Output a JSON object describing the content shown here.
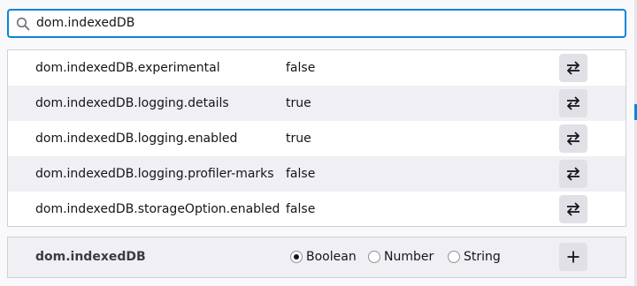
{
  "search": {
    "value": "dom.indexedDB"
  },
  "preferences": [
    {
      "name": "dom.indexedDB.experimental",
      "value": "false"
    },
    {
      "name": "dom.indexedDB.logging.details",
      "value": "true"
    },
    {
      "name": "dom.indexedDB.logging.enabled",
      "value": "true"
    },
    {
      "name": "dom.indexedDB.logging.profiler-marks",
      "value": "false"
    },
    {
      "name": "dom.indexedDB.storageOption.enabled",
      "value": "false"
    }
  ],
  "add_pref": {
    "name": "dom.indexedDB",
    "types": [
      "Boolean",
      "Number",
      "String"
    ],
    "selected_type": "Boolean"
  },
  "icons": {
    "search": "search-icon",
    "toggle": "toggle-arrows-icon",
    "add": "plus-icon"
  },
  "colors": {
    "accent": "#0a84d6",
    "row_alt": "#f0f0f4",
    "button": "#e0e0e6"
  }
}
